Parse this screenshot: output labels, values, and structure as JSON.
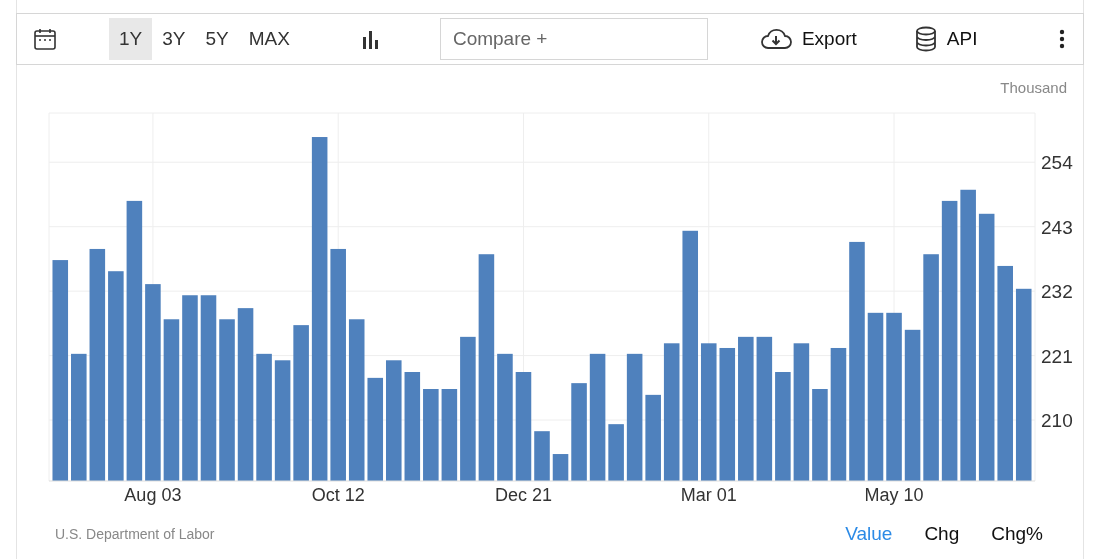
{
  "toolbar": {
    "ranges": [
      {
        "label": "1Y",
        "selected": true
      },
      {
        "label": "3Y",
        "selected": false
      },
      {
        "label": "5Y",
        "selected": false
      },
      {
        "label": "MAX",
        "selected": false
      }
    ],
    "compare": {
      "placeholder": "Compare +"
    },
    "export": "Export",
    "api": "API"
  },
  "chart": {
    "unit": "Thousand",
    "chart_data": {
      "type": "bar",
      "categories": [
        null,
        null,
        null,
        null,
        null,
        "Aug 03",
        null,
        null,
        null,
        null,
        null,
        null,
        null,
        null,
        null,
        "Oct 12",
        null,
        null,
        null,
        null,
        null,
        null,
        null,
        null,
        null,
        "Dec 21",
        null,
        null,
        null,
        null,
        null,
        null,
        null,
        null,
        null,
        "Mar 01",
        null,
        null,
        null,
        null,
        null,
        null,
        null,
        null,
        null,
        "May 10",
        null,
        null,
        null,
        null,
        null,
        null,
        null
      ],
      "series": [
        {
          "color": "#4f81bd",
          "values": [
            237.3,
            221.3,
            239.2,
            235.4,
            247.4,
            233.2,
            227.2,
            231.3,
            231.3,
            227.2,
            229.1,
            221.3,
            220.2,
            226.2,
            258.3,
            239.2,
            227.2,
            217.2,
            220.2,
            218.2,
            215.3,
            215.3,
            224.2,
            238.3,
            221.3,
            218.2,
            208.1,
            204.2,
            216.3,
            221.3,
            209.3,
            221.3,
            214.3,
            223.1,
            242.3,
            223.1,
            222.3,
            224.2,
            224.2,
            218.2,
            223.1,
            215.3,
            222.3,
            240.4,
            228.3,
            228.3,
            225.4,
            238.3,
            247.4,
            249.3,
            245.2,
            236.3,
            232.4
          ]
        }
      ],
      "grid": true,
      "ylim": [
        199.6,
        262.4
      ],
      "yticks": [
        210,
        221,
        232,
        243,
        254
      ]
    }
  },
  "footer": {
    "source": "U.S. Department of Labor",
    "views": [
      {
        "label": "Value",
        "selected": true
      },
      {
        "label": "Chg",
        "selected": false
      },
      {
        "label": "Chg%",
        "selected": false
      }
    ]
  }
}
